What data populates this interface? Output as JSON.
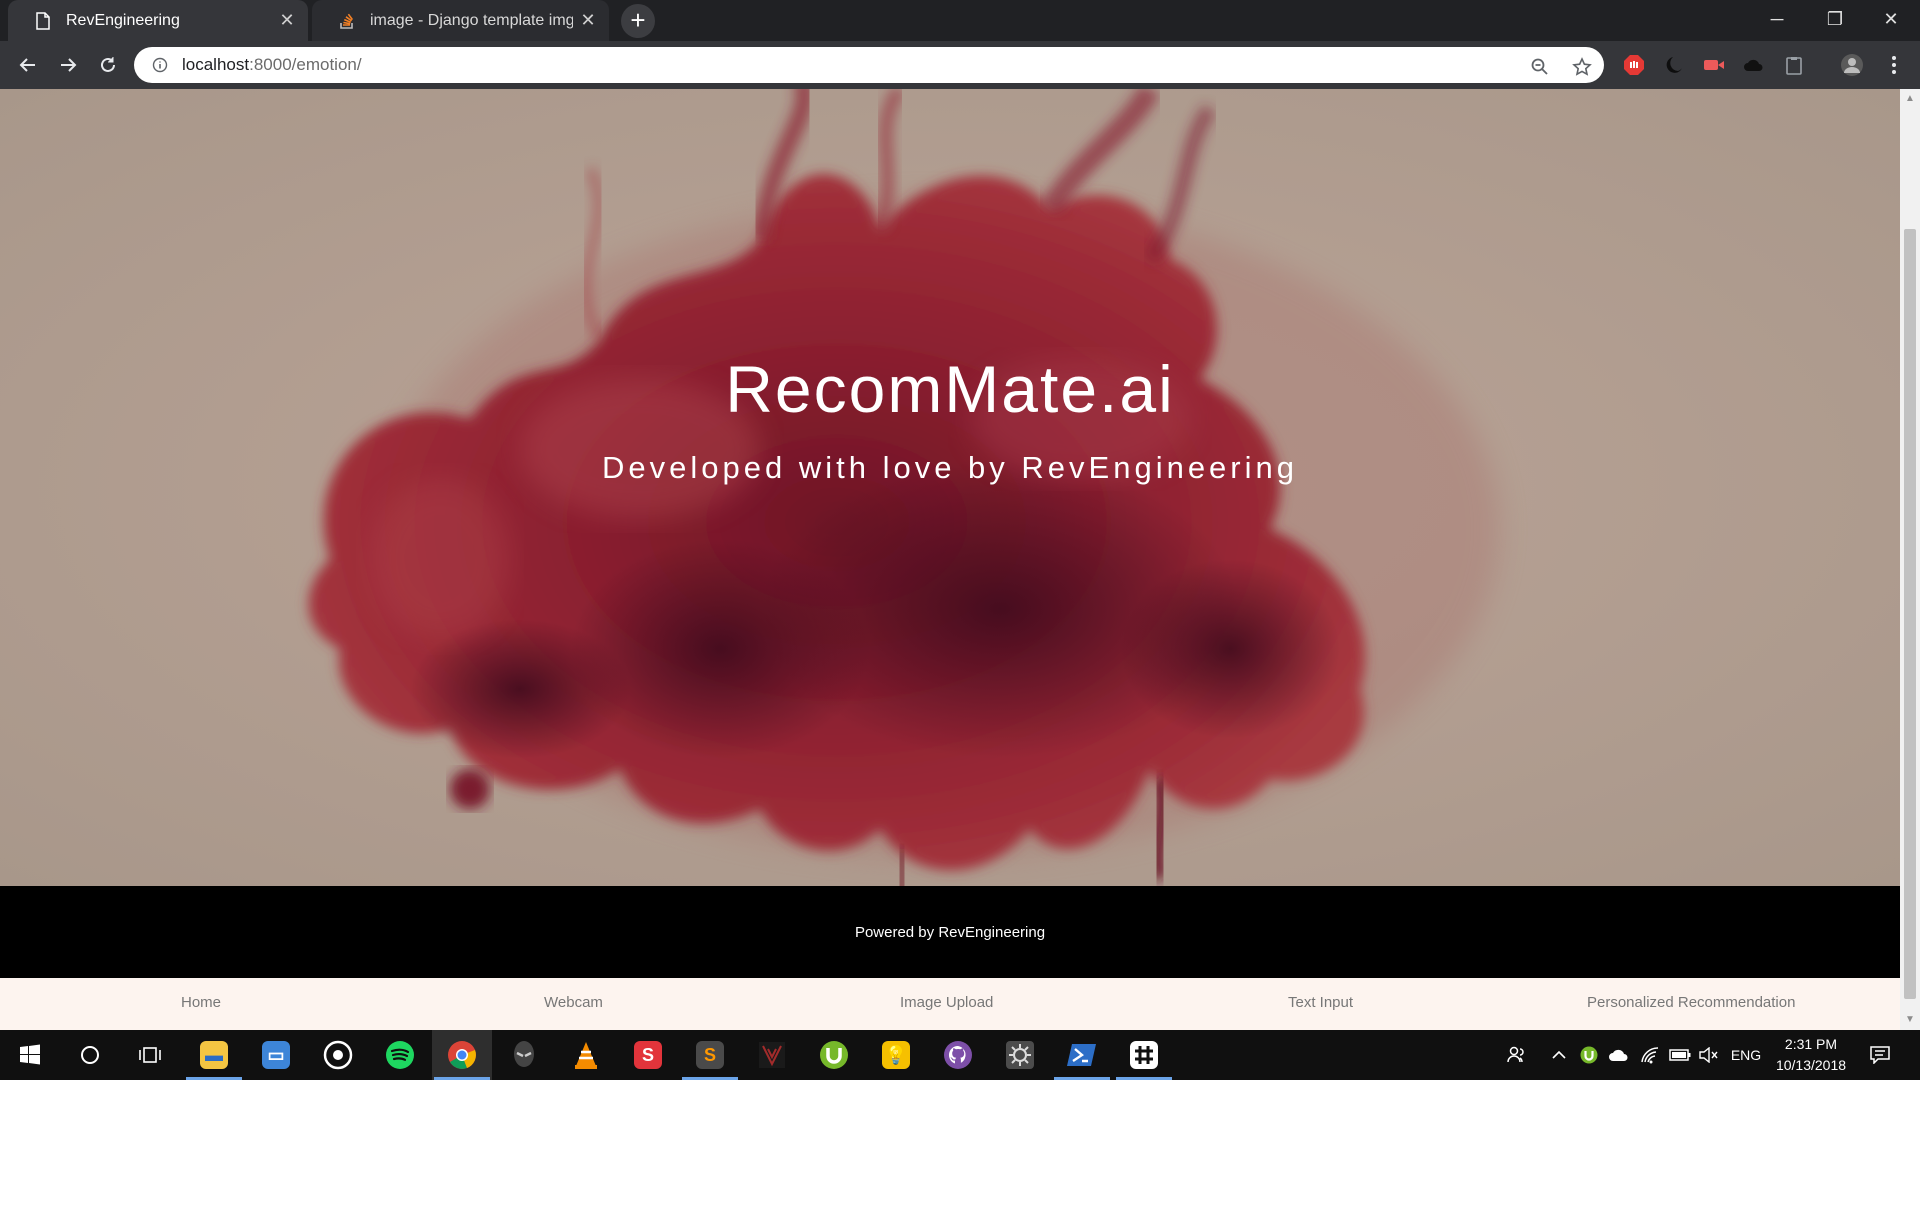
{
  "browser": {
    "tabs": [
      {
        "title": "RevEngineering",
        "icon": "page-icon",
        "active": true
      },
      {
        "title": "image - Django template img src",
        "icon": "stackoverflow-icon",
        "active": false
      }
    ],
    "new_tab_label": "+",
    "address": {
      "host": "localhost",
      "path": ":8000/emotion/"
    }
  },
  "page": {
    "hero": {
      "title": "RecomMate.ai",
      "subtitle": "Developed with love by RevEngineering"
    },
    "footer": {
      "text": "Powered by RevEngineering"
    },
    "nav": {
      "items": [
        "Home",
        "Webcam",
        "Image Upload",
        "Text Input",
        "Personalized Recommendation"
      ]
    }
  },
  "taskbar": {
    "apps": [
      "file-explorer-icon",
      "laptop-icon",
      "groove-music-icon",
      "spotify-icon",
      "chrome-icon",
      "alienware-icon",
      "vlc-icon",
      "s-app-icon",
      "sublime-text-icon",
      "predator-icon",
      "utorrent-icon",
      "bulb-app-icon",
      "github-icon",
      "anaconda-icon",
      "powershell-icon",
      "slack-icon"
    ],
    "tray": {
      "language": "ENG",
      "time": "2:31 PM",
      "date": "10/13/2018"
    }
  },
  "colors": {
    "hero_bg": "#b49f92",
    "ink": "#8a1e2e",
    "footer_bg": "#000000",
    "nav_bg": "#fdf4ef",
    "chrome_dark": "#202124"
  }
}
